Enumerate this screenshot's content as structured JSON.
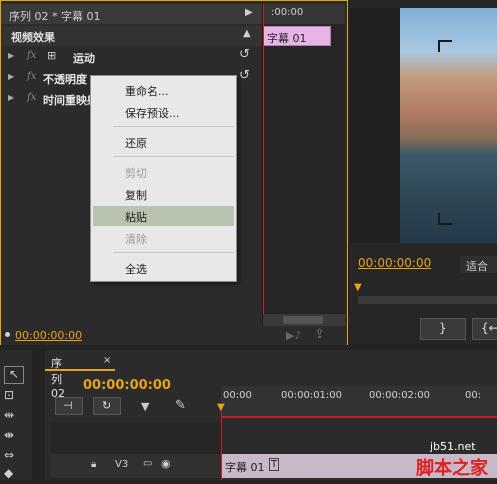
{
  "effect_controls": {
    "sequence_clip": "序列 02 * 字幕 01",
    "section_title": "视频效果",
    "effects": [
      {
        "fx": "fx",
        "icon": "motion-icon",
        "name": "运动"
      },
      {
        "fx": "fx",
        "name": "不透明度"
      },
      {
        "fx": "fx",
        "name": "时间重映射"
      }
    ],
    "ruler_time": ":00:00",
    "clip_name": "字幕 01",
    "footer_timecode": "00:00:00:00"
  },
  "context_menu": {
    "items": [
      {
        "label": "重命名...",
        "enabled": true
      },
      {
        "label": "保存预设...",
        "enabled": true
      },
      {
        "label": "还原",
        "enabled": true
      },
      {
        "label": "剪切",
        "enabled": false
      },
      {
        "label": "复制",
        "enabled": true
      },
      {
        "label": "粘贴",
        "enabled": true,
        "highlighted": true
      },
      {
        "label": "清除",
        "enabled": false
      },
      {
        "label": "全选",
        "enabled": true
      }
    ]
  },
  "program_monitor": {
    "timecode": "00:00:00:00",
    "fit_label": "适合",
    "buttons": [
      "}",
      "{←"
    ]
  },
  "timeline": {
    "tab_label": "序列 02",
    "tab_close": "×",
    "timecode": "00:00:00:00",
    "ruler_labels": [
      "00:00",
      "00:00:01:00",
      "00:00:02:00",
      "00:"
    ],
    "track_label": "V3",
    "clip_name": "字幕 01"
  },
  "watermark": {
    "url": "jb51.net",
    "text": "脚本之家"
  }
}
